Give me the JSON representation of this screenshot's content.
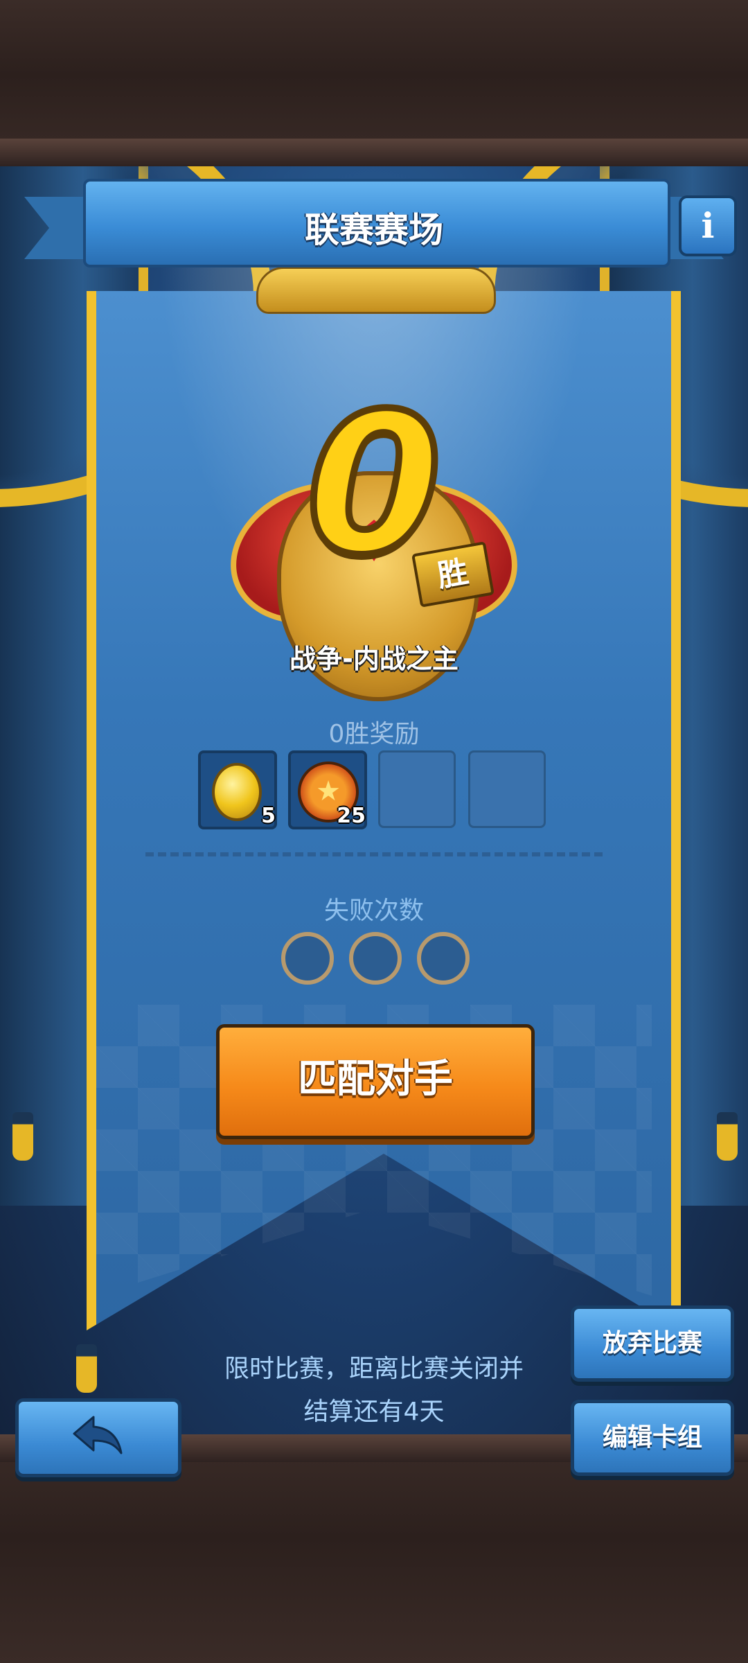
{
  "header": {
    "title": "联赛赛场",
    "info_icon": "i"
  },
  "emblem": {
    "wins": "0",
    "wins_badge": "胜",
    "rank_name": "战争-内战之主"
  },
  "rewards": {
    "title": "0胜奖励",
    "items": [
      {
        "icon": "gold-coin-icon",
        "quantity": "5"
      },
      {
        "icon": "star-medal-icon",
        "quantity": "25"
      }
    ],
    "empty_slots": 2
  },
  "failures": {
    "title": "失败次数",
    "max": 3,
    "used": 0
  },
  "actions": {
    "match_label": "匹配对手",
    "abandon_label": "放弃比赛",
    "edit_deck_label": "编辑卡组"
  },
  "notice": {
    "line1": "限时比赛，距离比赛关闭并",
    "line2": "结算还有4天"
  },
  "colors": {
    "accent_gold": "#f2c22e",
    "match_button": "#f68a1a",
    "banner_blue": "#3677b8"
  }
}
